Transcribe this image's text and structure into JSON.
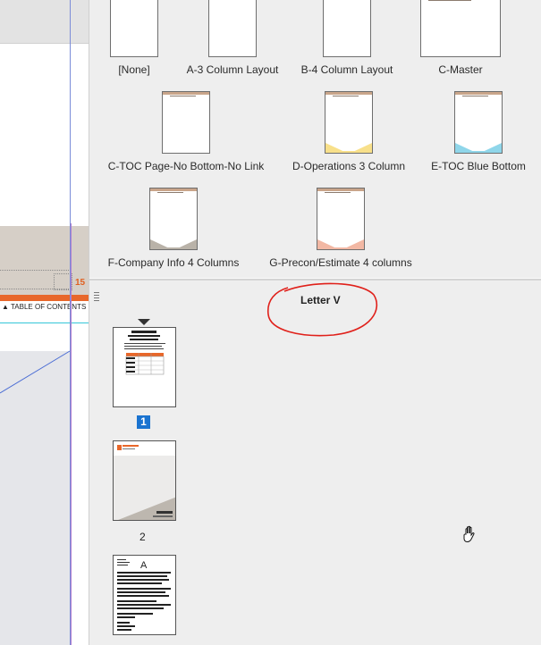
{
  "canvas": {
    "page_number": "15",
    "toc_strip_text": "▲ TABLE OF CONTENTS ▲"
  },
  "masters": [
    {
      "label": "[None]",
      "footer": "none"
    },
    {
      "label": "A-3 Column Layout",
      "footer": "none"
    },
    {
      "label": "B-4 Column Layout",
      "footer": "none"
    },
    {
      "label": "C-Master",
      "footer": "none"
    },
    {
      "label": "C-TOC Page-No Bottom-No Link",
      "footer": "none"
    },
    {
      "label": "D-Operations 3 Column",
      "footer": "#f8e08a"
    },
    {
      "label": "E-TOC Blue Bottom",
      "footer": "#8fd6ea"
    },
    {
      "label": "F-Company Info 4 Columns",
      "footer": "#b9b2a8"
    },
    {
      "label": "G-Precon/Estimate 4 columns",
      "footer": "#f2b8a4"
    }
  ],
  "section": {
    "label": "Letter V"
  },
  "pages": [
    {
      "number": "1",
      "selected": true
    },
    {
      "number": "2",
      "selected": false
    },
    {
      "number": "",
      "prefix": "A"
    }
  ],
  "colors": {
    "accent_orange": "#e8672a",
    "selection_blue": "#1a73d0",
    "annotation_red": "#e0201a"
  },
  "icons": {
    "grip": "grip-icon",
    "cursor": "hand-cursor-icon",
    "marker": "spread-marker-icon"
  }
}
